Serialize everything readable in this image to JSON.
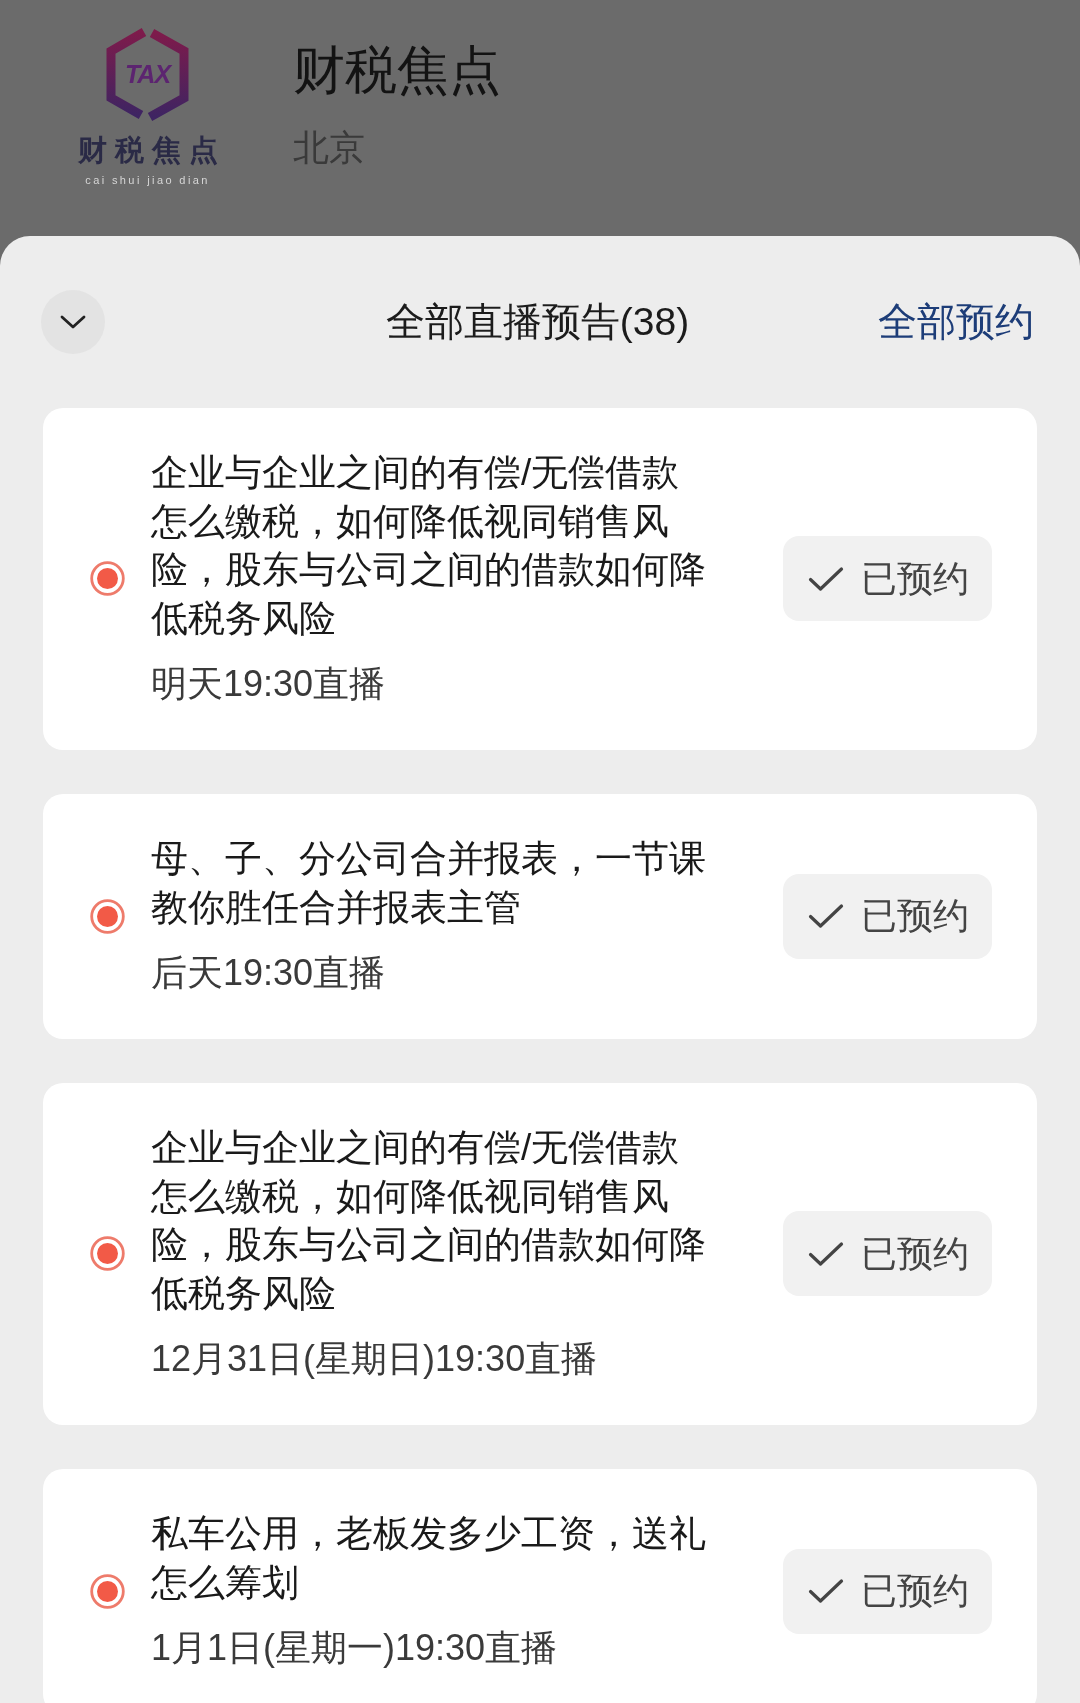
{
  "header": {
    "logo": {
      "mark": "TAX",
      "name": "财税焦点",
      "tagline": "cai shui jiao dian"
    },
    "title": "财税焦点",
    "location": "北京"
  },
  "sheet": {
    "title": "全部直播预告(38)",
    "action": "全部预约"
  },
  "broadcasts": [
    {
      "title": "企业与企业之间的有偿/无偿借款怎么缴税，如何降低视同销售风险，股东与公司之间的借款如何降低税务风险",
      "time": "明天19:30直播",
      "button": "已预约",
      "reserved": true
    },
    {
      "title": "母、子、分公司合并报表，一节课教你胜任合并报表主管",
      "time": "后天19:30直播",
      "button": "已预约",
      "reserved": true
    },
    {
      "title": "企业与企业之间的有偿/无偿借款怎么缴税，如何降低视同销售风险，股东与公司之间的借款如何降低税务风险",
      "time": "12月31日(星期日)19:30直播",
      "button": "已预约",
      "reserved": true
    },
    {
      "title": "私车公用，老板发多少工资，送礼怎么筹划",
      "time": "1月1日(星期一)19:30直播",
      "button": "已预约",
      "reserved": true
    }
  ]
}
